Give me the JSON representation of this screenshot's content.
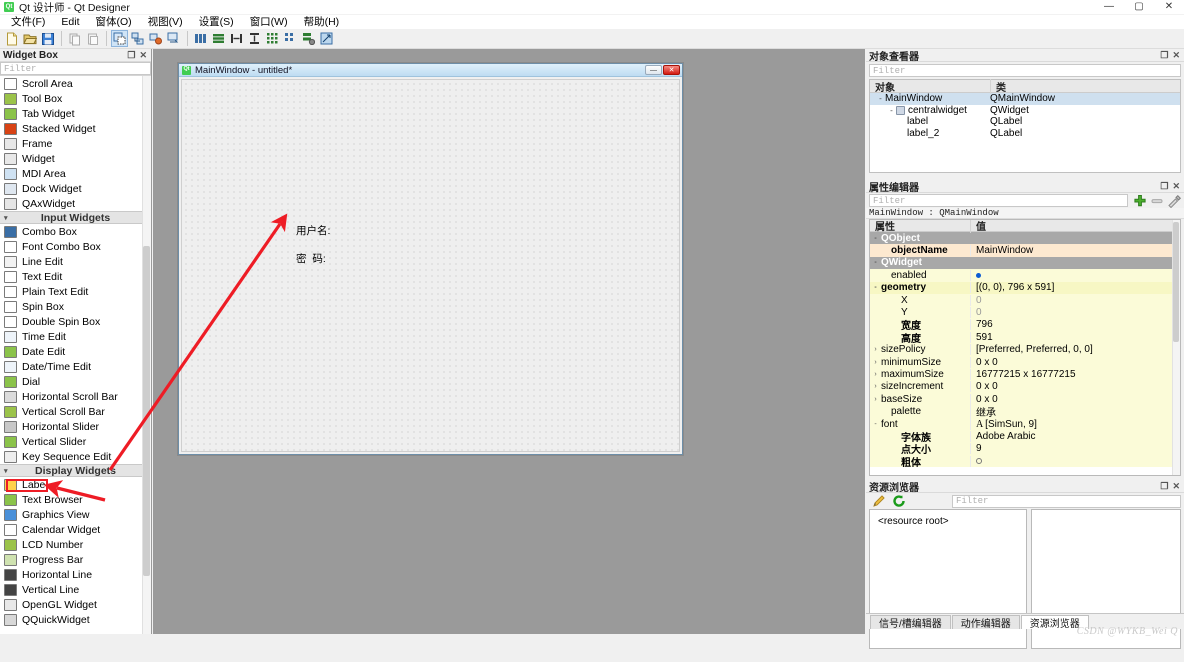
{
  "window": {
    "title": "Qt 设计师 - Qt Designer",
    "logo_text": "Qt",
    "minimize": "—",
    "maximize": "▢",
    "close": "✕"
  },
  "menubar": {
    "items": [
      {
        "label": "文件(F)"
      },
      {
        "label": "Edit"
      },
      {
        "label": "窗体(O)"
      },
      {
        "label": "视图(V)"
      },
      {
        "label": "设置(S)"
      },
      {
        "label": "窗口(W)"
      },
      {
        "label": "帮助(H)"
      }
    ]
  },
  "toolbar": {
    "buttons": [
      {
        "name": "new-form-button",
        "icon": "new-file-icon"
      },
      {
        "name": "open-form-button",
        "icon": "open-folder-icon"
      },
      {
        "name": "save-form-button",
        "icon": "save-disk-icon"
      },
      {
        "name": "cut-button",
        "icon": "copy-icon"
      },
      {
        "name": "paste-button",
        "icon": "paste-icon"
      },
      {
        "name": "edit-widgets-button",
        "icon": "edit-widgets-icon"
      },
      {
        "name": "edit-signals-slots-button",
        "icon": "signals-slots-icon"
      },
      {
        "name": "edit-buddies-button",
        "icon": "buddies-icon"
      },
      {
        "name": "edit-tab-order-button",
        "icon": "tab-order-icon"
      },
      {
        "name": "layout-horizontally-button",
        "icon": "layout-horizontal-icon"
      },
      {
        "name": "layout-vertically-button",
        "icon": "layout-vertical-icon"
      },
      {
        "name": "layout-splitter-h-button",
        "icon": "splitter-horizontal-icon"
      },
      {
        "name": "layout-splitter-v-button",
        "icon": "splitter-vertical-icon"
      },
      {
        "name": "layout-grid-button",
        "icon": "layout-grid-icon"
      },
      {
        "name": "layout-form-button",
        "icon": "layout-form-icon"
      },
      {
        "name": "break-layout-button",
        "icon": "break-layout-icon"
      },
      {
        "name": "adjust-size-button",
        "icon": "adjust-size-icon"
      }
    ]
  },
  "widget_box": {
    "title": "Widget Box",
    "filter_placeholder": "Filter",
    "undock_icon": "undock-icon",
    "close_icon": "close-icon",
    "items": [
      {
        "type": "item",
        "label": "Scroll Area",
        "icon": "scroll-area-icon"
      },
      {
        "type": "item",
        "label": "Tool Box",
        "icon": "tool-box-icon"
      },
      {
        "type": "item",
        "label": "Tab Widget",
        "icon": "tab-widget-icon"
      },
      {
        "type": "item",
        "label": "Stacked Widget",
        "icon": "stacked-widget-icon"
      },
      {
        "type": "item",
        "label": "Frame",
        "icon": "frame-icon"
      },
      {
        "type": "item",
        "label": "Widget",
        "icon": "widget-icon"
      },
      {
        "type": "item",
        "label": "MDI Area",
        "icon": "mdi-area-icon"
      },
      {
        "type": "item",
        "label": "Dock Widget",
        "icon": "dock-widget-icon"
      },
      {
        "type": "item",
        "label": "QAxWidget",
        "icon": "qaxwidget-icon"
      },
      {
        "type": "category",
        "label": "Input Widgets"
      },
      {
        "type": "item",
        "label": "Combo Box",
        "icon": "combo-box-icon"
      },
      {
        "type": "item",
        "label": "Font Combo Box",
        "icon": "font-combo-box-icon"
      },
      {
        "type": "item",
        "label": "Line Edit",
        "icon": "line-edit-icon"
      },
      {
        "type": "item",
        "label": "Text Edit",
        "icon": "text-edit-icon"
      },
      {
        "type": "item",
        "label": "Plain Text Edit",
        "icon": "plain-text-edit-icon"
      },
      {
        "type": "item",
        "label": "Spin Box",
        "icon": "spin-box-icon"
      },
      {
        "type": "item",
        "label": "Double Spin Box",
        "icon": "double-spin-box-icon"
      },
      {
        "type": "item",
        "label": "Time Edit",
        "icon": "time-edit-icon"
      },
      {
        "type": "item",
        "label": "Date Edit",
        "icon": "date-edit-icon"
      },
      {
        "type": "item",
        "label": "Date/Time Edit",
        "icon": "date-time-edit-icon"
      },
      {
        "type": "item",
        "label": "Dial",
        "icon": "dial-icon"
      },
      {
        "type": "item",
        "label": "Horizontal Scroll Bar",
        "icon": "horizontal-scroll-bar-icon"
      },
      {
        "type": "item",
        "label": "Vertical Scroll Bar",
        "icon": "vertical-scroll-bar-icon"
      },
      {
        "type": "item",
        "label": "Horizontal Slider",
        "icon": "horizontal-slider-icon"
      },
      {
        "type": "item",
        "label": "Vertical Slider",
        "icon": "vertical-slider-icon"
      },
      {
        "type": "item",
        "label": "Key Sequence Edit",
        "icon": "key-sequence-edit-icon"
      },
      {
        "type": "category",
        "label": "Display Widgets"
      },
      {
        "type": "item",
        "label": "Label",
        "icon": "label-icon",
        "highlighted": true
      },
      {
        "type": "item",
        "label": "Text Browser",
        "icon": "text-browser-icon"
      },
      {
        "type": "item",
        "label": "Graphics View",
        "icon": "graphics-view-icon"
      },
      {
        "type": "item",
        "label": "Calendar Widget",
        "icon": "calendar-widget-icon"
      },
      {
        "type": "item",
        "label": "LCD Number",
        "icon": "lcd-number-icon"
      },
      {
        "type": "item",
        "label": "Progress Bar",
        "icon": "progress-bar-icon"
      },
      {
        "type": "item",
        "label": "Horizontal Line",
        "icon": "horizontal-line-icon"
      },
      {
        "type": "item",
        "label": "Vertical Line",
        "icon": "vertical-line-icon"
      },
      {
        "type": "item",
        "label": "OpenGL Widget",
        "icon": "opengl-widget-icon"
      },
      {
        "type": "item",
        "label": "QQuickWidget",
        "icon": "qquickwidget-icon"
      }
    ]
  },
  "form_window": {
    "title": "MainWindow - untitled*",
    "logo_text": "Qt",
    "minimize": "—",
    "close": "✕",
    "labels": [
      {
        "name": "username-label",
        "text": "用户名:"
      },
      {
        "name": "password-label",
        "text": "密  码:"
      }
    ]
  },
  "object_inspector": {
    "title": "对象查看器",
    "filter_placeholder": "Filter",
    "columns": [
      "对象",
      "类"
    ],
    "rows": [
      {
        "name": "MainWindow",
        "class": "QMainWindow",
        "indent": 0,
        "twisty": "-",
        "selected": true
      },
      {
        "name": "centralwidget",
        "class": "QWidget",
        "indent": 1,
        "twisty": "-",
        "icon": true
      },
      {
        "name": "label",
        "class": "QLabel",
        "indent": 2,
        "twisty": ""
      },
      {
        "name": "label_2",
        "class": "QLabel",
        "indent": 2,
        "twisty": ""
      }
    ]
  },
  "property_editor": {
    "title": "属性编辑器",
    "filter_placeholder": "Filter",
    "object_class": "MainWindow : QMainWindow",
    "columns": [
      "属性",
      "值"
    ],
    "add_icon": "plus-icon",
    "remove_icon": "minus-icon",
    "configure_icon": "configure-icon",
    "rows": [
      {
        "key": "QObject",
        "value": "",
        "style": "group",
        "twisty": "-"
      },
      {
        "key": "objectName",
        "value": "MainWindow",
        "style": "highlight",
        "bold": true,
        "indent": 1
      },
      {
        "key": "QWidget",
        "value": "",
        "style": "group",
        "twisty": "-"
      },
      {
        "key": "enabled",
        "value": "",
        "style": "yellow",
        "indent": 1,
        "widget": "checkbox-checked"
      },
      {
        "key": "geometry",
        "value": "[(0, 0), 796 x 591]",
        "style": "yellow-strong",
        "bold": true,
        "twisty": "-"
      },
      {
        "key": "X",
        "value": "0",
        "style": "yellow",
        "indent": 2,
        "muted": true
      },
      {
        "key": "Y",
        "value": "0",
        "style": "yellow",
        "indent": 2,
        "muted": true
      },
      {
        "key": "宽度",
        "value": "796",
        "style": "yellow",
        "indent": 2,
        "bold": true
      },
      {
        "key": "高度",
        "value": "591",
        "style": "yellow",
        "indent": 2,
        "bold": true
      },
      {
        "key": "sizePolicy",
        "value": "[Preferred, Preferred, 0, 0]",
        "style": "yellow",
        "twisty": "›"
      },
      {
        "key": "minimumSize",
        "value": "0 x 0",
        "style": "yellow",
        "twisty": "›"
      },
      {
        "key": "maximumSize",
        "value": "16777215 x 16777215",
        "style": "yellow",
        "twisty": "›"
      },
      {
        "key": "sizeIncrement",
        "value": "0 x 0",
        "style": "yellow",
        "twisty": "›"
      },
      {
        "key": "baseSize",
        "value": "0 x 0",
        "style": "yellow",
        "twisty": "›"
      },
      {
        "key": "palette",
        "value": "继承",
        "style": "yellow",
        "indent": 1
      },
      {
        "key": "font",
        "value": "[SimSun, 9]",
        "value_prefix": "A",
        "style": "yellow",
        "twisty": "-"
      },
      {
        "key": "字体族",
        "value": "Adobe Arabic",
        "style": "yellow",
        "indent": 2,
        "bold": true
      },
      {
        "key": "点大小",
        "value": "9",
        "style": "yellow",
        "indent": 2,
        "bold": true
      },
      {
        "key": "粗体",
        "value": "",
        "style": "yellow",
        "indent": 2,
        "bold": true,
        "widget": "checkbox-empty"
      }
    ]
  },
  "resource_browser": {
    "title": "资源浏览器",
    "filter_placeholder": "Filter",
    "edit_icon": "pencil-icon",
    "reload_icon": "reload-icon",
    "root_label": "<resource root>"
  },
  "bottom_tabs": {
    "items": [
      {
        "label": "信号/槽编辑器",
        "active": false
      },
      {
        "label": "动作编辑器",
        "active": false
      },
      {
        "label": "资源浏览器",
        "active": true
      }
    ]
  },
  "annotations": {
    "arrow_color": "#ee1c25",
    "highlight_color": "#ee1c25"
  },
  "watermark": {
    "text": "CSDN @WYKB_Wei Q"
  }
}
